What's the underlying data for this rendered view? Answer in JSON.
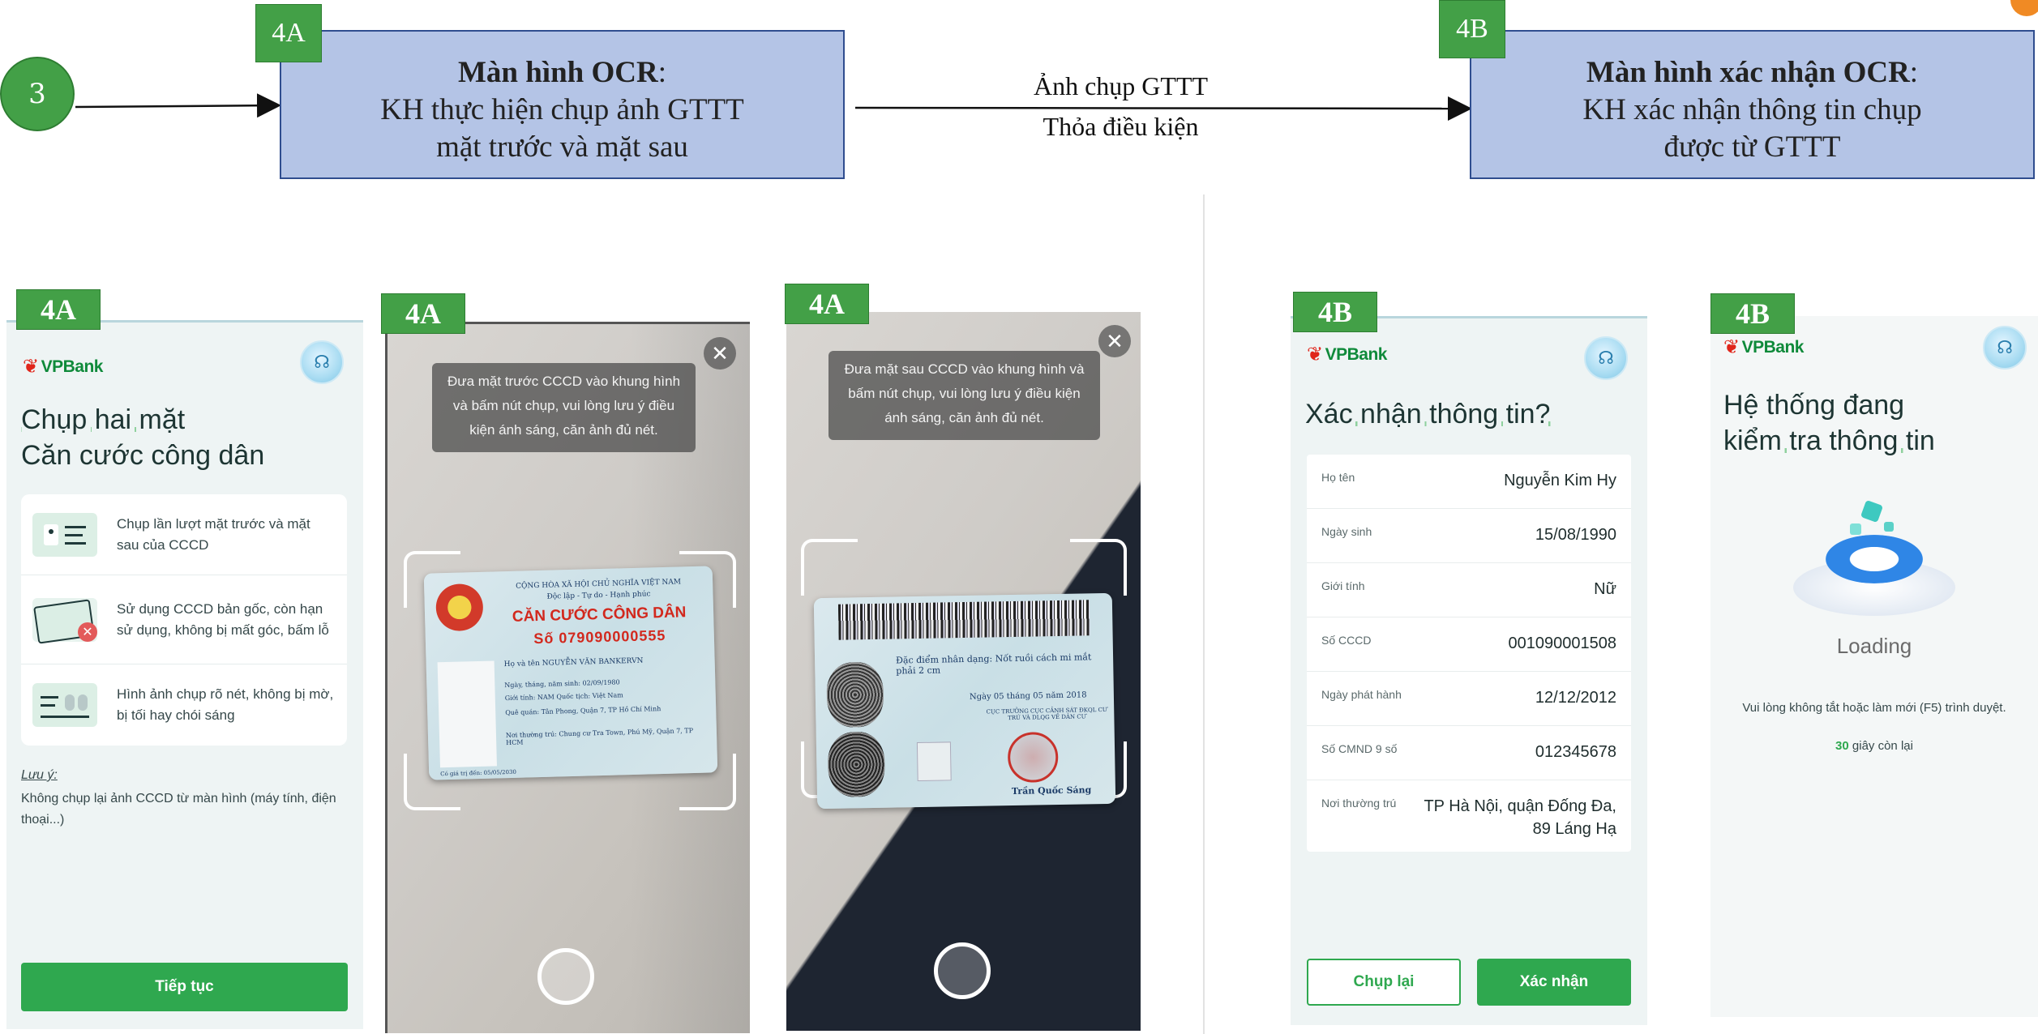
{
  "flow": {
    "step_number": "3",
    "box_a": {
      "tag": "4A",
      "title": "Màn hình OCR",
      "line1": "KH thực hiện chụp ảnh GTTT",
      "line2": "mặt trước và mặt sau"
    },
    "box_b": {
      "tag": "4B",
      "title": "Màn hình xác nhận OCR",
      "line1": "KH xác nhận thông tin chụp",
      "line2": "được từ GTTT"
    },
    "arrow_label_top": "Ảnh chụp GTTT",
    "arrow_label_bottom": "Thỏa điều kiện"
  },
  "colors": {
    "tag_green": "#43a047",
    "box_fill": "#b4c4e6",
    "box_border": "#2f4d8f",
    "button_green": "#2fa84f",
    "brand_red": "#e0261b"
  },
  "screen_instructions": {
    "tag": "4A",
    "logo": "VPBank",
    "title_line1": "Chụp hai mặt",
    "title_line2": "Căn cước công dân",
    "tips": [
      {
        "icon": "id-card-icon",
        "text": "Chụp lần lượt mặt trước và mặt sau của CCCD"
      },
      {
        "icon": "damaged-card-icon",
        "text": "Sử dụng CCCD bản gốc, còn hạn sử dụng, không bị mất góc, bấm lỗ"
      },
      {
        "icon": "clear-image-icon",
        "text": "Hình ảnh chụp rõ nét, không bị mờ, bị tối hay chói sáng"
      }
    ],
    "note_label": "Lưu ý:",
    "note_text": "Không chụp lại ảnh CCCD từ màn hình (máy tính, điện thoại...)",
    "button": "Tiếp tục"
  },
  "screen_front": {
    "tag": "4A",
    "message": "Đưa mặt trước CCCD vào khung hình và bấm nút chụp, vui lòng lưu ý điều kiện ánh sáng, căn ảnh đủ nét.",
    "card": {
      "header1": "CỘNG HÒA XÃ HỘI CHỦ NGHĨA VIỆT NAM",
      "header2": "Độc lập - Tự do - Hạnh phúc",
      "title": "CĂN CƯỚC CÔNG DÂN",
      "number": "Số 079090000555",
      "name": "Họ và tên NGUYỄN VĂN BANKERVN",
      "dob": "Ngày, tháng, năm sinh: 02/09/1980",
      "sex": "Giới tính: NAM   Quốc tịch: Việt Nam",
      "origin": "Quê quán: Tân Phong, Quận 7, TP Hồ Chí Minh",
      "residence": "Nơi thường trú: Chung cư Tra Town, Phú Mỹ, Quận 7, TP HCM",
      "expiry": "Có giá trị đến: 05/05/2030"
    }
  },
  "screen_back": {
    "tag": "4A",
    "message": "Đưa mặt sau CCCD vào khung hình và bấm nút chụp, vui lòng lưu ý điều kiện ánh sáng, căn ảnh đủ nét.",
    "card": {
      "feature": "Đặc điểm nhân dạng: Nốt ruồi cách mi mắt phải 2 cm",
      "date": "Ngày 05 tháng 05 năm 2018",
      "authority": "CỤC TRƯỞNG CỤC CẢNH SÁT ĐKQL CƯ TRÚ VÀ DLQG VỀ DÂN CƯ",
      "signer": "Trần Quốc Sáng"
    }
  },
  "screen_confirm": {
    "tag": "4B",
    "logo": "VPBank",
    "title": "Xác nhận thông tin?",
    "rows": [
      {
        "label": "Họ tên",
        "value": "Nguyễn Kim Hy"
      },
      {
        "label": "Ngày sinh",
        "value": "15/08/1990"
      },
      {
        "label": "Giới tính",
        "value": "Nữ"
      },
      {
        "label": "Số CCCD",
        "value": "001090001508"
      },
      {
        "label": "Ngày phát hành",
        "value": "12/12/2012"
      },
      {
        "label": "Số CMND 9 số",
        "value": "012345678"
      },
      {
        "label": "Nơi thường trú",
        "value": "TP Hà Nội, quận Đống Đa, 89 Láng Hạ"
      }
    ],
    "retake_button": "Chụp lại",
    "confirm_button": "Xác nhận"
  },
  "screen_loading": {
    "tag": "4B",
    "logo": "VPBank",
    "title_line1": "Hệ thống đang",
    "title_line2": "kiểm tra thông tin",
    "loading_text": "Loading",
    "notice": "Vui lòng không tắt hoặc làm mới (F5) trình duyệt.",
    "countdown_number": "30",
    "countdown_suffix": "giây còn lại"
  }
}
